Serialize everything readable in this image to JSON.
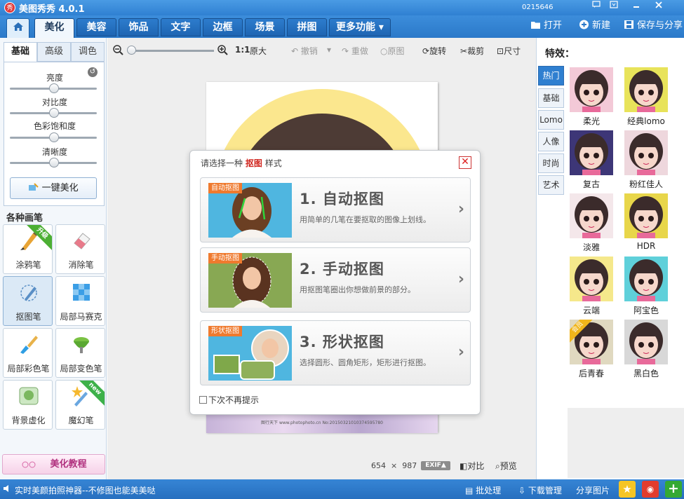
{
  "titlebar": {
    "logo_text": "秀",
    "app_title": "美图秀秀 4.0.1",
    "user_id": "0215646"
  },
  "nav": {
    "tabs": [
      "美化",
      "美容",
      "饰品",
      "文字",
      "边框",
      "场景",
      "拼图"
    ],
    "more": "更多功能 ▾",
    "open": "打开",
    "new": "新建",
    "save_share": "保存与分享"
  },
  "left": {
    "subtabs": [
      "基础",
      "高级",
      "调色"
    ],
    "sliders": [
      "亮度",
      "对比度",
      "色彩饱和度",
      "清晰度"
    ],
    "one_key": "一键美化",
    "brushes_header": "各种画笔",
    "brushes": [
      {
        "label": "涂鸦笔",
        "badge": "升级"
      },
      {
        "label": "消除笔"
      },
      {
        "label": "抠图笔"
      },
      {
        "label": "局部马赛克"
      },
      {
        "label": "局部彩色笔"
      },
      {
        "label": "局部变色笔"
      },
      {
        "label": "背景虚化"
      },
      {
        "label": "魔幻笔",
        "badge": "new"
      }
    ],
    "tutorial": "美化教程"
  },
  "toolbar": {
    "ratio": "1:1",
    "original_size": "原大",
    "undo": "撤销",
    "redo": "重做",
    "orig": "原图",
    "rotate": "旋转",
    "crop": "裁剪",
    "size": "尺寸"
  },
  "canvas": {
    "width": "654",
    "times": "×",
    "height": "987",
    "exif": "EXIF▲",
    "compare": "对比",
    "preview": "预览",
    "watermark": "图行天下 www.photophoto.cn No:20150321010374595780"
  },
  "dialog": {
    "title_pre": "请选择一种",
    "title_key": "抠图",
    "title_post": "样式",
    "options": [
      {
        "tag": "自动抠图",
        "title": "1. 自动抠图",
        "desc": "用简单的几笔在要抠取的图像上划线。"
      },
      {
        "tag": "手动抠图",
        "title": "2. 手动抠图",
        "desc": "用抠图笔圈出你想做前景的部分。"
      },
      {
        "tag": "形状抠图",
        "title": "3. 形状抠图",
        "desc": "选择圆形、圆角矩形，矩形进行抠图。"
      }
    ],
    "dont_show": "下次不再提示"
  },
  "right": {
    "header": "特效：",
    "categories": [
      "热门",
      "基础",
      "Lomo",
      "人像",
      "时尚",
      "艺术"
    ],
    "effects": [
      {
        "label": "柔光",
        "bg": "#f3c9d7"
      },
      {
        "label": "经典lomo",
        "bg": "#e8e35a"
      },
      {
        "label": "复古",
        "bg": "#3d3677"
      },
      {
        "label": "粉红佳人",
        "bg": "#eed7dd"
      },
      {
        "label": "淡雅",
        "bg": "#f4e7ea"
      },
      {
        "label": "HDR",
        "bg": "#e8d64a"
      },
      {
        "label": "云端",
        "bg": "#f5e88b"
      },
      {
        "label": "阿宝色",
        "bg": "#5fd0da"
      },
      {
        "label": "后青春",
        "bg": "#e0d9c0",
        "badge": "会员"
      },
      {
        "label": "黑白色",
        "bg": "#d8d8d8"
      }
    ]
  },
  "status": {
    "left_text": "实时美颜拍照神器--不修图也能美美哒",
    "batch": "批处理",
    "download": "下载管理",
    "share": "分享图片"
  }
}
